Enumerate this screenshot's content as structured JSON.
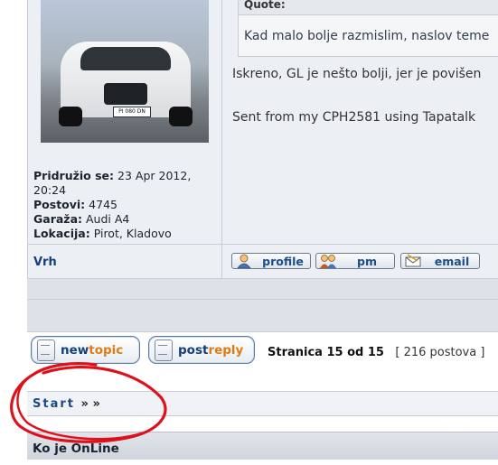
{
  "user": {
    "plate_text": "PI 080 DN",
    "joined_label": "Pridružio se:",
    "joined_value": "23 Apr 2012,",
    "joined_time": "20:24",
    "posts_label": "Postovi:",
    "posts_value": "4745",
    "garage_label": "Garaža:",
    "garage_value": "Audi A4",
    "location_label": "Lokacija:",
    "location_value": "Pirot, Kladovo"
  },
  "post": {
    "quote_label": "Quote:",
    "quote_text": "Kad malo bolje razmislim, naslov teme",
    "body_text": "Iskreno, GL je nešto bolji, jer je povišen",
    "signature": "Sent from my CPH2581 using Tapatalk"
  },
  "post_footer": {
    "top_link": "Vrh",
    "profile": "profile",
    "pm": "pm",
    "email": "email"
  },
  "actions": {
    "newtopic_a": "new",
    "newtopic_b": "topic",
    "postreply_a": "post",
    "postreply_b": "reply"
  },
  "pagination": {
    "page_text": "Stranica 15 od 15",
    "post_count": "[ 216 postova ]"
  },
  "nav": {
    "start_label": "Start",
    "arrows": "» »"
  },
  "online": {
    "title": "Ko je OnLine"
  },
  "colors": {
    "accent_red": "#e0101a",
    "link_blue": "#1a4a86",
    "orange": "#e07b16"
  }
}
